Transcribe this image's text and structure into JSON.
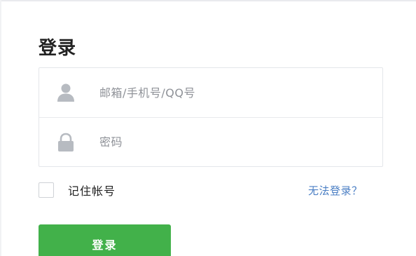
{
  "login": {
    "title": "登录",
    "account_placeholder": "邮箱/手机号/QQ号",
    "account_value": "",
    "password_placeholder": "密码",
    "password_value": "",
    "remember_label": "记住帐号",
    "remember_checked": false,
    "forgot_link": "无法登录？",
    "submit_label": "登录"
  },
  "icons": {
    "account": "user-icon",
    "password": "lock-icon"
  },
  "colors": {
    "primary_button": "#42b14a",
    "link": "#4b7fc4",
    "icon": "#b7bbc1"
  }
}
